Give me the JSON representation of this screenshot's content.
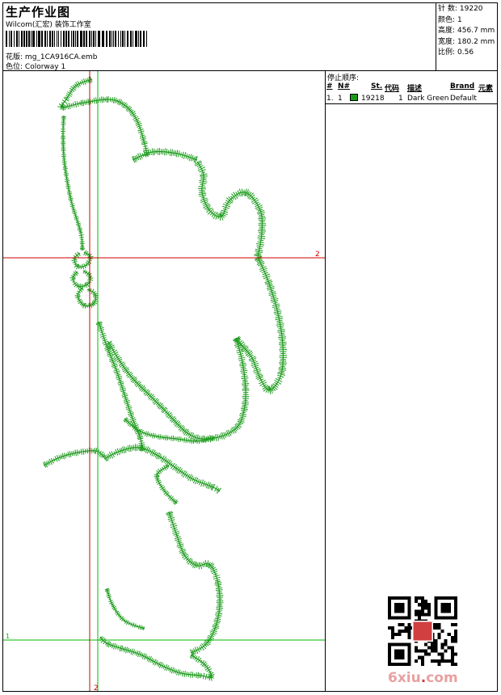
{
  "header": {
    "title": "生产作业图",
    "company": "Wilcom(汇宏) 装饰工作室",
    "design_label": "花版:",
    "design_name": "mg_1CA916CA.emb",
    "color_label": "色位:",
    "colorway": "Colorway 1"
  },
  "stats": [
    {
      "label": "针 数:",
      "value": "19220"
    },
    {
      "label": "颜色:",
      "value": "1"
    },
    {
      "label": "高度:",
      "value": "456.7 mm"
    },
    {
      "label": "宽度:",
      "value": "180.2 mm"
    },
    {
      "label": "比例:",
      "value": "0.56"
    }
  ],
  "stop_sequence": {
    "title": "停止顺序:",
    "columns": [
      "#",
      "N#",
      "St.",
      "代码",
      "描述",
      "Brand",
      "元素"
    ],
    "rows": [
      {
        "index": "1.",
        "n": "1",
        "stitches": "19218",
        "code": "1",
        "description": "Dark Green",
        "brand": "Default",
        "color": "#1a9a1a"
      }
    ]
  },
  "design": {
    "thread_color": "#1a9a1a",
    "axis_red": "#cc0000",
    "axis_green": "#00bb00",
    "axis_label_2": "2",
    "axis_label_1": "1"
  },
  "watermark": {
    "text_a": "6xiu",
    "text_dot": ".",
    "text_b": "com"
  }
}
